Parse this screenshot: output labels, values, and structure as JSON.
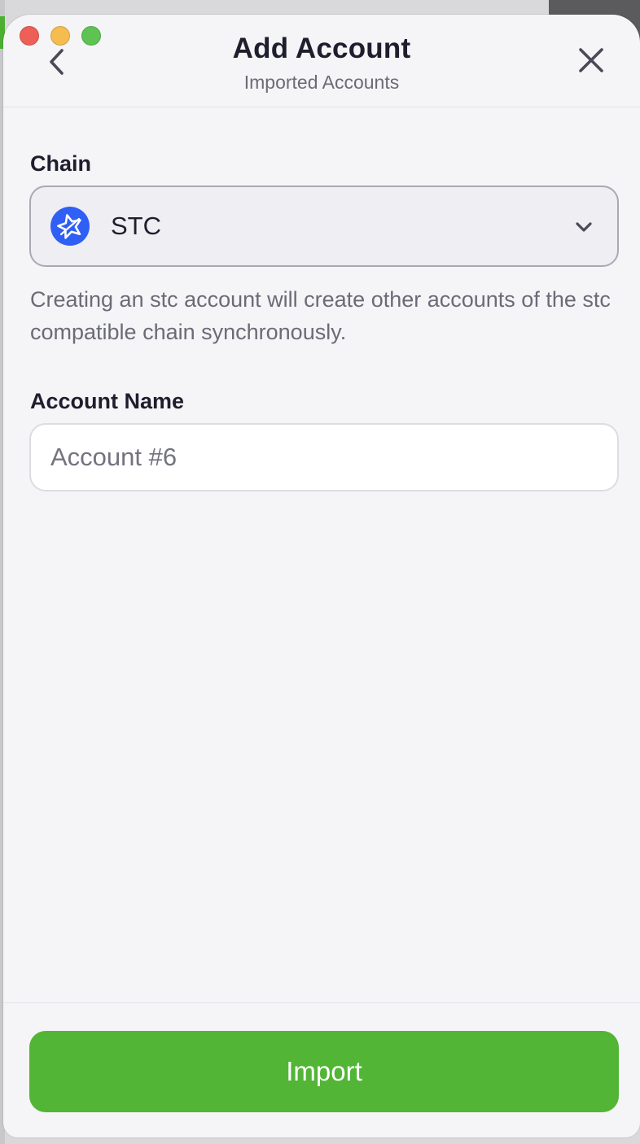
{
  "window": {
    "controls": [
      "close",
      "minimize",
      "zoom"
    ]
  },
  "header": {
    "title": "Add Account",
    "subtitle": "Imported Accounts",
    "back_icon": "chevron-left-icon",
    "close_icon": "close-icon"
  },
  "chain": {
    "label": "Chain",
    "selected": "STC",
    "logo_icon": "stc-star-icon",
    "accent_color": "#2f5ff5",
    "dropdown_icon": "chevron-down-icon",
    "hint": "Creating an stc account will create other accounts of the stc compatible chain synchronously."
  },
  "account_name": {
    "label": "Account Name",
    "placeholder": "Account #6",
    "value": ""
  },
  "footer": {
    "import_label": "Import",
    "import_color": "#52b536"
  }
}
